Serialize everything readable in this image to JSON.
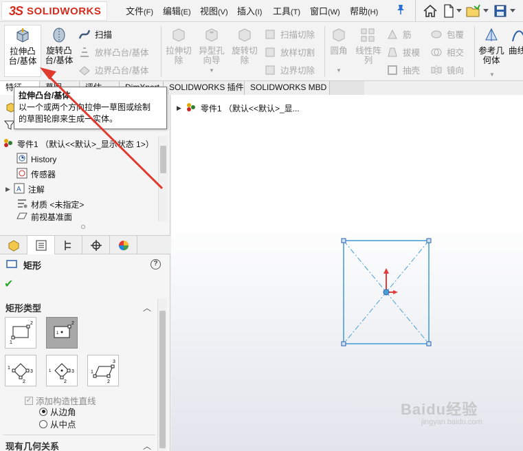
{
  "app": {
    "logo_ds": "3S",
    "logo_name": "SOLIDWORKS"
  },
  "menu": [
    {
      "label": "文件",
      "hotkey": "(F)"
    },
    {
      "label": "编辑",
      "hotkey": "(E)"
    },
    {
      "label": "视图",
      "hotkey": "(V)"
    },
    {
      "label": "插入",
      "hotkey": "(I)"
    },
    {
      "label": "工具",
      "hotkey": "(T)"
    },
    {
      "label": "窗口",
      "hotkey": "(W)"
    },
    {
      "label": "帮助",
      "hotkey": "(H)"
    }
  ],
  "ribbon": {
    "extrude_boss": "拉伸凸台/基体",
    "revolve_boss": "旋转凸台/基体",
    "sweep": "扫描",
    "loft_boss": "放样凸台/基体",
    "boundary_boss": "边界凸台/基体",
    "extrude_cut": "拉伸切除",
    "hole_wizard": "异型孔向导",
    "revolve_cut": "旋转切除",
    "swept_cut": "扫描切除",
    "lofted_cut": "放样切割",
    "boundary_cut": "边界切除",
    "fillet": "圆角",
    "linear_pattern": "线性阵列",
    "rib": "筋",
    "draft": "拔模",
    "shell": "抽壳",
    "wrap": "包覆",
    "intersect": "相交",
    "mirror": "镜向",
    "ref_geometry": "参考几何体",
    "curves": "曲线"
  },
  "tabs": [
    "特征",
    "草图",
    "评估",
    "DimXpert",
    "SOLIDWORKS 插件",
    "SOLIDWORKS MBD"
  ],
  "tooltip": {
    "title": "拉伸凸台/基体",
    "body_line1": "以一个或两个方向拉伸一草图或绘制",
    "body_line2": "的草图轮廓来生成一实体。"
  },
  "feature_tree": {
    "part": "零件1 （默认<<默认>_显示状态 1>）",
    "items": [
      "History",
      "传感器",
      "注解",
      "材质 <未指定>",
      "前视基准面"
    ]
  },
  "property_manager": {
    "title": "矩形",
    "section_type": "矩形类型",
    "add_construction": "添加构造性直线",
    "from_corner": "从边角",
    "from_midpoint": "从中点",
    "section_relations": "现有几何关系"
  },
  "canvas": {
    "flyout_part": "零件1 （默认<<默认>_显..."
  },
  "watermark": {
    "main": "Baidu经验",
    "sub": "jingyan.baidu.com"
  },
  "colors": {
    "sketch_line": "#4a9fd8",
    "arrow": "#e23b3b",
    "accent_red": "#d52b1e"
  }
}
